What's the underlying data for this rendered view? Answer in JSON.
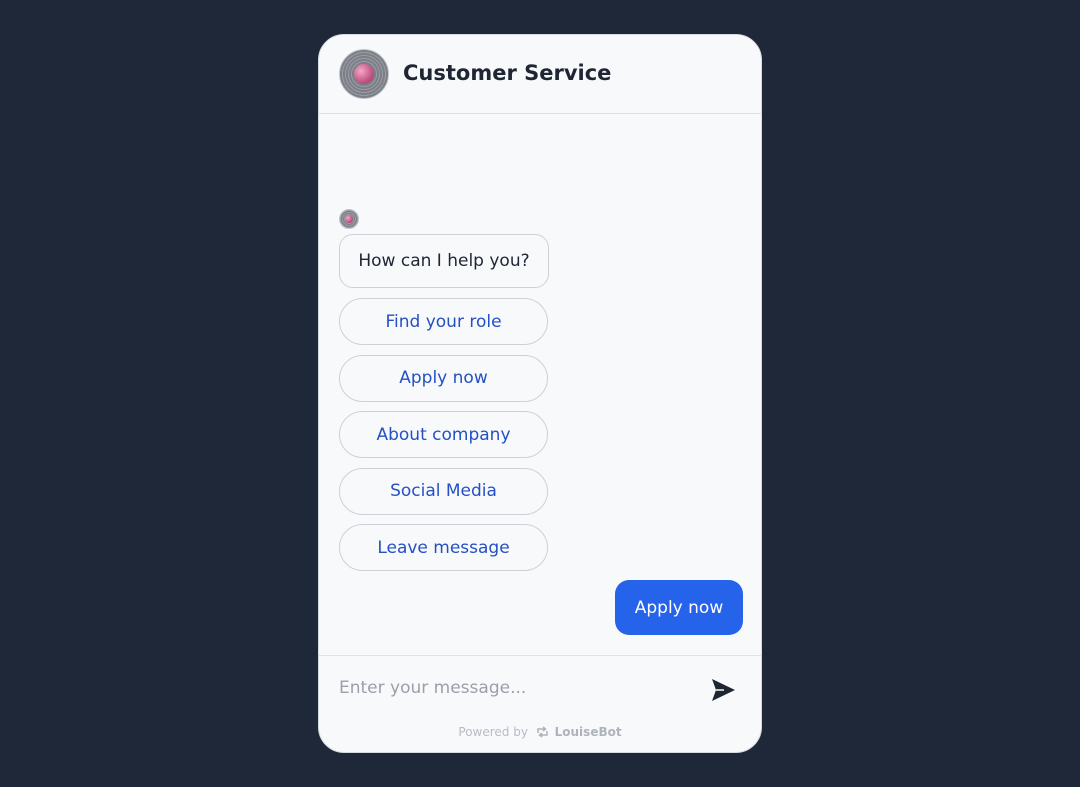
{
  "header": {
    "title": "Customer Service",
    "avatar_icon": "pink-sphere-avatar-icon"
  },
  "conversation": {
    "bot_message": "How can I help you?",
    "options": [
      {
        "label": "Find your role"
      },
      {
        "label": "Apply now"
      },
      {
        "label": "About company"
      },
      {
        "label": "Social Media"
      },
      {
        "label": "Leave message"
      }
    ],
    "user_message": "Apply now"
  },
  "composer": {
    "placeholder": "Enter your message...",
    "send_icon": "send-arrow-icon"
  },
  "footer": {
    "powered_prefix": "Powered by",
    "brand": "LouiseBot"
  },
  "colors": {
    "background": "#1f2838",
    "panel": "#f8f9fb",
    "accent": "#2563eb",
    "option_text": "#2450c4"
  }
}
